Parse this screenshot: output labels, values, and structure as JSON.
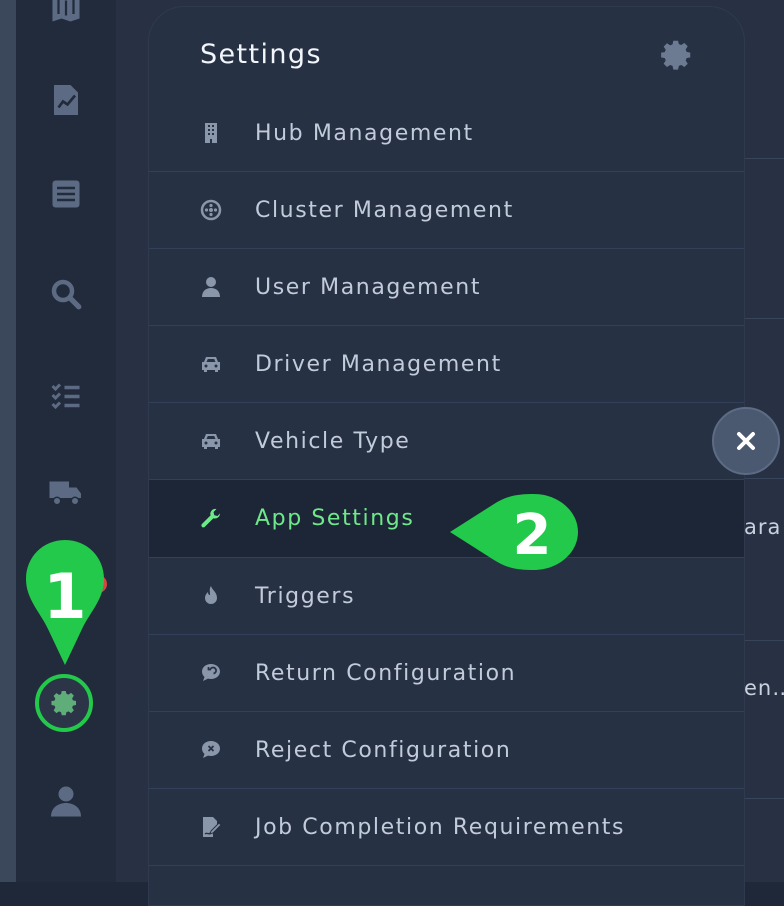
{
  "panel": {
    "title": "Settings",
    "items": [
      {
        "label": "Hub Management",
        "icon": "building-icon"
      },
      {
        "label": "Cluster Management",
        "icon": "cluster-icon"
      },
      {
        "label": "User Management",
        "icon": "user-icon"
      },
      {
        "label": "Driver Management",
        "icon": "car-icon"
      },
      {
        "label": "Vehicle Type",
        "icon": "car-icon"
      },
      {
        "label": "App Settings",
        "icon": "wrench-icon",
        "active": true
      },
      {
        "label": "Triggers",
        "icon": "fire-icon"
      },
      {
        "label": "Return Configuration",
        "icon": "return-chat-icon"
      },
      {
        "label": "Reject Configuration",
        "icon": "reject-chat-icon"
      },
      {
        "label": "Job Completion Requirements",
        "icon": "signature-icon"
      }
    ]
  },
  "background": {
    "row_text_1": "ara",
    "row_text_2": "en…"
  },
  "markers": {
    "step1": "1",
    "step2": "2"
  },
  "colors": {
    "accent_green": "#22c94a",
    "active_label": "#6ee98a",
    "panel_bg": "#273144",
    "sidebar_bg": "#222b3b"
  },
  "sidebar_icons": [
    "map-icon",
    "report-icon",
    "list-icon",
    "search-icon",
    "checklist-icon",
    "truck-icon",
    "gear-icon",
    "user-icon"
  ]
}
